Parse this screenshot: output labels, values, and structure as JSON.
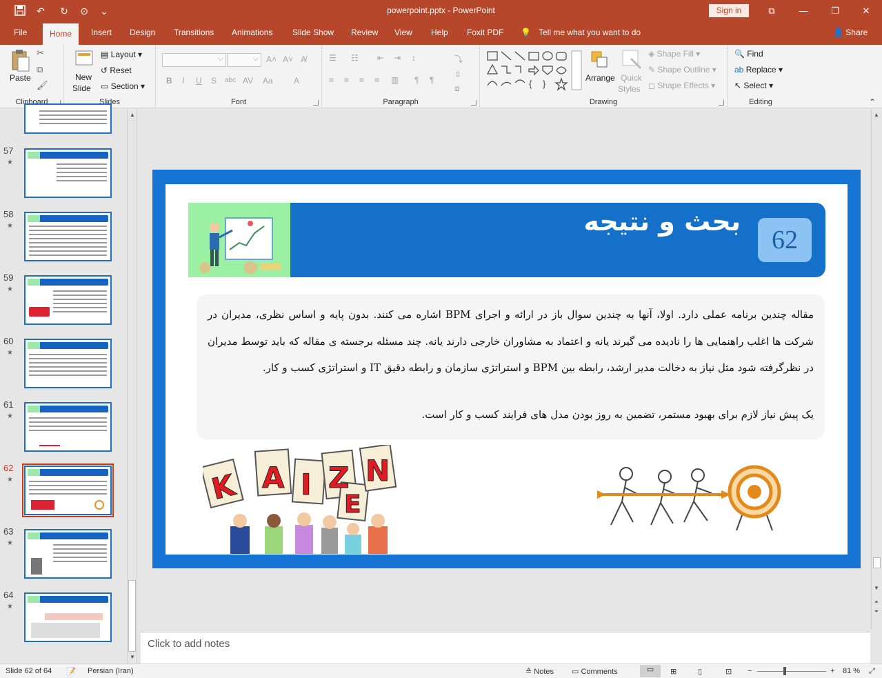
{
  "titlebar": {
    "title": "powerpoint.pptx  -  PowerPoint",
    "sign_in": "Sign in"
  },
  "tabs": [
    {
      "label": "File"
    },
    {
      "label": "Home"
    },
    {
      "label": "Insert"
    },
    {
      "label": "Design"
    },
    {
      "label": "Transitions"
    },
    {
      "label": "Animations"
    },
    {
      "label": "Slide Show"
    },
    {
      "label": "Review"
    },
    {
      "label": "View"
    },
    {
      "label": "Help"
    },
    {
      "label": "Foxit PDF"
    }
  ],
  "tell_me": "Tell me what you want to do",
  "share": "Share",
  "ribbon": {
    "clipboard": {
      "paste": "Paste",
      "label": "Clipboard"
    },
    "slides": {
      "new_slide_1": "New",
      "new_slide_2": "Slide",
      "layout": "Layout",
      "reset": "Reset",
      "section": "Section",
      "label": "Slides"
    },
    "font": {
      "label": "Font"
    },
    "paragraph": {
      "label": "Paragraph"
    },
    "drawing": {
      "arrange": "Arrange",
      "quick_styles_1": "Quick",
      "quick_styles_2": "Styles",
      "shape_fill": "Shape Fill",
      "shape_outline": "Shape Outline",
      "shape_effects": "Shape Effects",
      "label": "Drawing"
    },
    "editing": {
      "find": "Find",
      "replace": "Replace",
      "select": "Select",
      "label": "Editing"
    }
  },
  "thumbnails": [
    {
      "num": "57"
    },
    {
      "num": "58"
    },
    {
      "num": "59"
    },
    {
      "num": "60"
    },
    {
      "num": "61"
    },
    {
      "num": "62"
    },
    {
      "num": "63"
    },
    {
      "num": "64"
    }
  ],
  "slide": {
    "title": "بحث و نتیجه",
    "number": "62",
    "paragraph": "مقاله چندین برنامه عملی دارد. اولا، آنها به چندین سوال باز در ارائه و اجرای BPM اشاره می کنند. بدون پایه و اساس نظری، مدیران در شرکت ها اغلب راهنمایی ها را نادیده می گیرند یانه و اعتماد به مشاوران خارجی دارند یانه. چند مسئله برجسته ی مقاله که باید توسط مدیران در نظرگرفته شود مثل نیاز به دخالت مدیر ارشد، رابطه بین BPM و استراتژی سازمان و رابطه دقیق IT و استراتژی کسب و کار.",
    "paragraph2": "یک پیش نیاز لازم برای بهبود مستمر، تضمین به روز بودن مدل های فرایند کسب و کار است.",
    "kaizen_letters": [
      "K",
      "A",
      "I",
      "Z",
      "E",
      "N"
    ]
  },
  "notes_placeholder": "Click to add notes",
  "status": {
    "slide_of": "Slide 62 of 64",
    "language": "Persian (Iran)",
    "notes": "Notes",
    "comments": "Comments",
    "zoom": "81 %"
  }
}
